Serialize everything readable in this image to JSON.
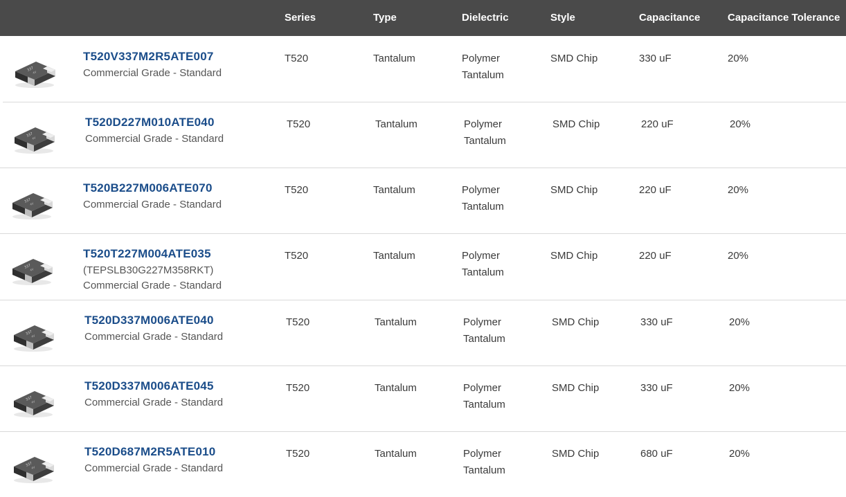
{
  "columns": {
    "series": "Series",
    "type": "Type",
    "dielectric": "Dielectric",
    "style": "Style",
    "capacitance": "Capacitance",
    "tolerance": "Capacitance Tolerance"
  },
  "rows": [
    {
      "part": "T520V337M2R5ATE007",
      "alt": "",
      "grade": "Commercial Grade - Standard",
      "series": "T520",
      "type": "Tantalum",
      "dielectric_1": "Polymer",
      "dielectric_2": "Tantalum",
      "style": "SMD Chip",
      "capacitance": "330 uF",
      "tolerance": "20%"
    },
    {
      "part": "T520D227M010ATE040",
      "alt": "",
      "grade": "Commercial Grade - Standard",
      "series": "T520",
      "type": "Tantalum",
      "dielectric_1": "Polymer",
      "dielectric_2": "Tantalum",
      "style": "SMD Chip",
      "capacitance": "220 uF",
      "tolerance": "20%"
    },
    {
      "part": "T520B227M006ATE070",
      "alt": "",
      "grade": "Commercial Grade - Standard",
      "series": "T520",
      "type": "Tantalum",
      "dielectric_1": "Polymer",
      "dielectric_2": "Tantalum",
      "style": "SMD Chip",
      "capacitance": "220 uF",
      "tolerance": "20%"
    },
    {
      "part": "T520T227M004ATE035",
      "alt": "(TEPSLB30G227M358RKT)",
      "grade": "Commercial Grade - Standard",
      "series": "T520",
      "type": "Tantalum",
      "dielectric_1": "Polymer",
      "dielectric_2": "Tantalum",
      "style": "SMD Chip",
      "capacitance": "220 uF",
      "tolerance": "20%"
    },
    {
      "part": "T520D337M006ATE040",
      "alt": "",
      "grade": "Commercial Grade - Standard",
      "series": "T520",
      "type": "Tantalum",
      "dielectric_1": "Polymer",
      "dielectric_2": "Tantalum",
      "style": "SMD Chip",
      "capacitance": "330 uF",
      "tolerance": "20%"
    },
    {
      "part": "T520D337M006ATE045",
      "alt": "",
      "grade": "Commercial Grade - Standard",
      "series": "T520",
      "type": "Tantalum",
      "dielectric_1": "Polymer",
      "dielectric_2": "Tantalum",
      "style": "SMD Chip",
      "capacitance": "330 uF",
      "tolerance": "20%"
    },
    {
      "part": "T520D687M2R5ATE010",
      "alt": "",
      "grade": "Commercial Grade - Standard",
      "series": "T520",
      "type": "Tantalum",
      "dielectric_1": "Polymer",
      "dielectric_2": "Tantalum",
      "style": "SMD Chip",
      "capacitance": "680 uF",
      "tolerance": "20%"
    }
  ],
  "colors": {
    "header_bg": "#4a4a4a",
    "part_link": "#1b4d8a",
    "divider": "#d9d9d9"
  }
}
